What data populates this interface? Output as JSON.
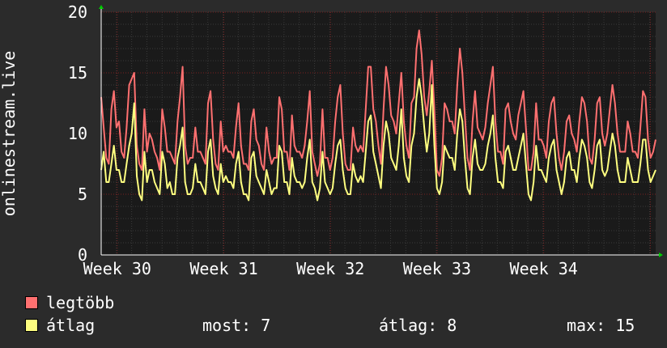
{
  "chart_data": {
    "type": "line",
    "ylabel": "onlinestream.live",
    "ylim": [
      0,
      20
    ],
    "yticks": [
      0,
      5,
      10,
      15,
      20
    ],
    "xticks": [
      "Week 30",
      "Week 31",
      "Week 32",
      "Week 33",
      "Week 34"
    ],
    "xlim": [
      0,
      5.2
    ],
    "grid": true,
    "colors": {
      "background": "#2b2b2b",
      "plot": "#1a1a1a",
      "grid_minor": "#3a3a3a",
      "grid_major": "#7a2020",
      "axis": "#ffffff",
      "arrow": "#00cc00"
    },
    "series": [
      {
        "name": "legtöbb",
        "color": "#ff7070",
        "values": [
          13,
          10.5,
          8,
          7.5,
          12,
          13.5,
          10.5,
          11,
          8.5,
          8,
          10.5,
          14,
          14.5,
          15,
          9,
          7.5,
          7,
          12,
          8.5,
          10,
          9.5,
          8.5,
          8,
          7,
          12,
          10.5,
          8.5,
          8.5,
          8,
          7.5,
          11,
          13,
          15.5,
          9,
          7.5,
          8,
          8,
          10.5,
          8.5,
          8.5,
          8,
          7.5,
          12.5,
          13.5,
          9.5,
          7.5,
          7,
          11,
          8.5,
          9,
          8.5,
          8.5,
          8,
          10.5,
          12.5,
          9,
          7.5,
          7.5,
          7,
          11,
          12,
          9.5,
          9,
          7.5,
          7,
          10.5,
          8.5,
          7.5,
          8,
          8,
          13,
          12,
          8.5,
          8.5,
          7,
          11.5,
          9,
          8.5,
          8.5,
          8,
          9,
          11,
          13.5,
          8.5,
          7.5,
          6.5,
          7.5,
          12,
          8,
          8,
          7,
          8,
          11,
          13,
          14,
          10,
          7.5,
          7,
          7,
          10.5,
          9,
          8.5,
          9,
          8.5,
          12,
          15.5,
          15.5,
          12,
          11,
          9,
          7.5,
          12,
          15.5,
          14,
          11.5,
          11,
          10,
          12.5,
          15,
          11,
          9,
          8,
          12.5,
          13,
          17,
          18.5,
          16.5,
          13,
          11.5,
          13.5,
          16,
          12,
          7,
          6.5,
          8,
          12.5,
          12,
          11,
          11,
          10,
          14,
          17,
          15,
          11.5,
          8,
          7,
          11,
          13.5,
          10.5,
          10,
          9.5,
          10.5,
          12.5,
          14,
          15.5,
          11,
          8.5,
          8.5,
          7.5,
          12,
          12.5,
          11,
          10,
          9.5,
          11.5,
          12.5,
          13.5,
          10.5,
          7,
          7,
          8.5,
          12.5,
          9.5,
          9.5,
          9,
          8,
          11,
          12.5,
          13,
          10,
          8,
          7,
          8.5,
          11,
          11.5,
          10,
          9.5,
          8.5,
          11,
          13,
          12.5,
          11,
          8,
          7.5,
          9.5,
          12.5,
          13,
          10,
          9,
          10,
          12,
          14,
          12.5,
          10,
          8.5,
          8.5,
          8.5,
          11,
          10,
          8.5,
          8.5,
          8,
          10.5,
          13.5,
          13,
          9.5,
          8,
          8.5,
          9.5
        ],
        "values_note": ""
      },
      {
        "name": "átlag",
        "color": "#ffff80",
        "values": [
          7,
          8.5,
          6,
          6,
          7.5,
          9,
          7,
          7,
          6,
          6,
          7.5,
          9,
          10,
          12.5,
          6.5,
          5,
          4.5,
          8.5,
          6,
          7,
          7,
          6,
          5.5,
          5,
          8.5,
          7.5,
          5.5,
          6,
          5,
          5,
          8,
          9,
          10.5,
          6,
          5,
          5,
          5.5,
          7.5,
          6,
          6,
          5.5,
          5,
          8.5,
          9.5,
          6.5,
          5.5,
          5,
          7.5,
          6,
          6.5,
          6,
          6,
          5.5,
          7.5,
          8.5,
          6,
          5,
          5,
          4.5,
          8,
          8.5,
          6.5,
          6,
          5.5,
          5,
          7,
          6,
          5,
          5.5,
          5.5,
          9,
          8.5,
          6,
          6,
          5,
          8,
          6.5,
          6,
          6,
          5.5,
          6,
          8,
          9.5,
          6,
          5.5,
          4.5,
          5.5,
          8.5,
          6,
          5.5,
          5,
          5.5,
          7.5,
          9,
          9.5,
          7,
          5.5,
          5,
          5,
          7.5,
          6.5,
          6,
          6.5,
          6,
          8.5,
          11,
          11.5,
          8.5,
          7.5,
          6.5,
          5.5,
          9,
          11,
          10,
          8,
          7.5,
          7,
          9,
          12,
          8,
          6.5,
          6,
          9,
          10,
          13,
          14.5,
          13,
          10.5,
          8.5,
          10,
          14,
          9,
          5.5,
          5,
          6,
          9,
          8.5,
          8,
          8,
          7,
          10,
          12,
          11,
          8,
          5.5,
          5,
          8,
          9.5,
          7.5,
          7,
          7,
          7.5,
          9,
          10,
          11.5,
          8,
          6,
          6,
          5.5,
          8.5,
          9,
          8,
          7,
          7,
          8,
          9,
          10,
          7.5,
          5,
          4.5,
          6,
          9,
          7,
          7,
          6.5,
          6,
          8,
          9,
          9.5,
          7,
          6,
          5,
          6,
          8,
          8.5,
          7,
          7,
          6,
          8,
          9.5,
          9,
          8,
          6,
          5.5,
          7,
          9,
          9.5,
          7,
          6.5,
          7,
          8.5,
          10,
          9,
          7,
          6,
          6,
          6,
          8,
          7,
          6,
          6,
          6,
          7.5,
          9.5,
          9.5,
          7,
          6,
          6.5,
          7
        ]
      }
    ]
  },
  "legend": {
    "items": [
      {
        "label": "legtöbb",
        "color": "#ff7070"
      },
      {
        "label": "átlag",
        "color": "#ffff80"
      }
    ],
    "stats": {
      "now_label": "most:",
      "now_value": "7",
      "avg_label": "átlag:",
      "avg_value": "8",
      "max_label": "max:",
      "max_value": "15"
    }
  }
}
